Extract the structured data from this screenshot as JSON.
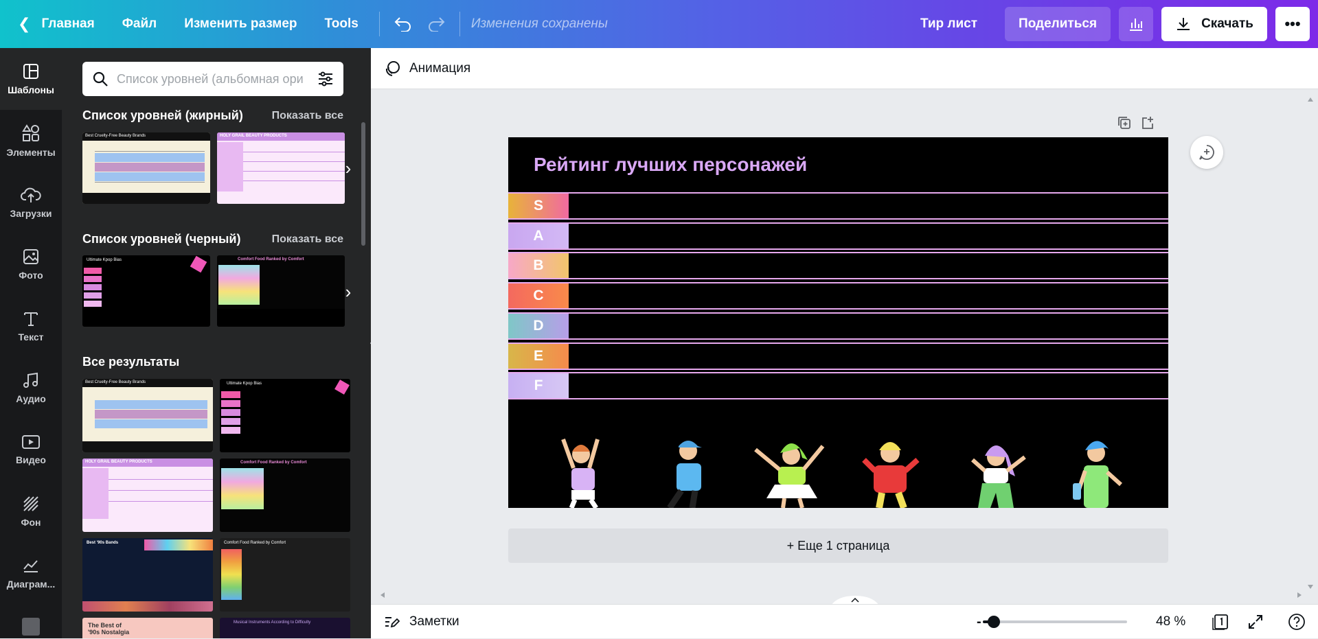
{
  "topbar": {
    "home": "Главная",
    "file": "Файл",
    "resize": "Изменить размер",
    "tools": "Tools",
    "saved_status": "Изменения сохранены",
    "design_name": "Тир лист",
    "share": "Поделиться",
    "download": "Скачать"
  },
  "rail": {
    "items": [
      {
        "label": "Шаблоны",
        "icon": "templates-icon"
      },
      {
        "label": "Элементы",
        "icon": "elements-icon"
      },
      {
        "label": "Загрузки",
        "icon": "upload-cloud-icon"
      },
      {
        "label": "Фото",
        "icon": "photo-icon"
      },
      {
        "label": "Текст",
        "icon": "text-icon"
      },
      {
        "label": "Аудио",
        "icon": "audio-icon"
      },
      {
        "label": "Видео",
        "icon": "video-icon"
      },
      {
        "label": "Фон",
        "icon": "background-icon"
      },
      {
        "label": "Диаграм...",
        "icon": "chart-icon"
      }
    ]
  },
  "panel": {
    "search_placeholder": "Список уровней (альбомная ори",
    "sections": [
      {
        "title": "Список уровней (жирный)",
        "show_all": "Показать все"
      },
      {
        "title": "Список уровней (черный)",
        "show_all": "Показать все"
      },
      {
        "title": "Все результаты"
      }
    ],
    "thumbs": {
      "cruelty": "Best Cruelty-Free Beauty Brands",
      "holygrail": "HOLY GRAIL BEAUTY PRODUCTS",
      "kpop": "Ultimate Kpop Bias",
      "comfort": "Comfort Food Ranked by Comfort",
      "bands": "Best '90s Bands",
      "nostalgia_1": "The Best of",
      "nostalgia_2": "'90s Nostalgia",
      "instruments": "Musical Instruments According to Difficulty"
    }
  },
  "editor": {
    "animation": "Анимация",
    "design_title": "Рейтинг лучших персонажей",
    "tiers": [
      {
        "label": "S",
        "color_a": "#e8b33a",
        "color_b": "#f06aa0"
      },
      {
        "label": "A",
        "color_a": "#c9a7f0",
        "color_b": "#d3b9f5"
      },
      {
        "label": "B",
        "color_a": "#f7a8c8",
        "color_b": "#f2c56b"
      },
      {
        "label": "C",
        "color_a": "#f4695f",
        "color_b": "#f98a4a"
      },
      {
        "label": "D",
        "color_a": "#7fc7c7",
        "color_b": "#b79ee8"
      },
      {
        "label": "E",
        "color_a": "#d8b64a",
        "color_b": "#f58b4c"
      },
      {
        "label": "F",
        "color_a": "#c7b0f2",
        "color_b": "#d7c8f5"
      }
    ],
    "more_pages": "+ Еще 1 страница"
  },
  "bottombar": {
    "notes": "Заметки",
    "zoom": "48 %",
    "zoom_level": 0.08
  }
}
